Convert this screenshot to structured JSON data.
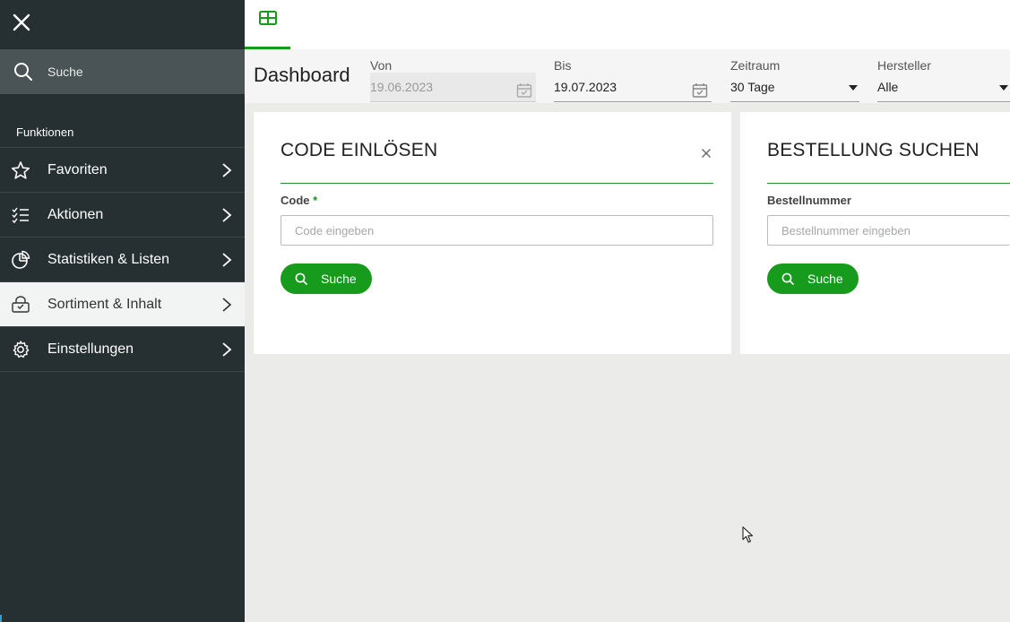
{
  "sidebar": {
    "search_label": "Suche",
    "section_title": "Funktionen",
    "items": [
      {
        "label": "Favoriten",
        "icon": "star-icon"
      },
      {
        "label": "Aktionen",
        "icon": "checklist-icon"
      },
      {
        "label": "Statistiken & Listen",
        "icon": "pie-chart-icon"
      },
      {
        "label": "Sortiment & Inhalt",
        "icon": "basket-icon",
        "active": true
      },
      {
        "label": "Einstellungen",
        "icon": "gear-icon"
      }
    ]
  },
  "header": {
    "tab_icon": "grid-icon"
  },
  "filters": {
    "title": "Dashboard",
    "von": {
      "label": "Von",
      "value": "19.06.2023"
    },
    "bis": {
      "label": "Bis",
      "value": "19.07.2023"
    },
    "zeitraum": {
      "label": "Zeitraum",
      "value": "30 Tage"
    },
    "hersteller": {
      "label": "Hersteller",
      "value": "Alle"
    }
  },
  "cards": [
    {
      "title": "CODE EINLÖSEN",
      "field_label": "Code",
      "required_mark": "*",
      "placeholder": "Code eingeben",
      "button_label": "Suche"
    },
    {
      "title": "BESTELLUNG SUCHEN",
      "field_label": "Bestellnummer",
      "placeholder": "Bestellnummer eingeben",
      "button_label": "Suche"
    }
  ],
  "colors": {
    "sidebar_bg": "#263033",
    "accent_green": "#169b1c",
    "page_bg": "#ebecea"
  }
}
